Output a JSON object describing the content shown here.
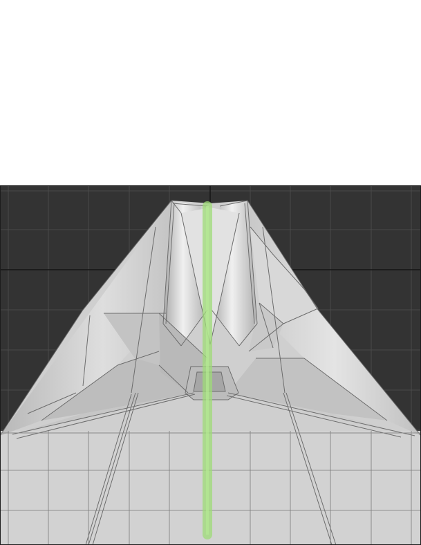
{
  "viewport": {
    "background_color": "#333333",
    "grid_color": "#4a4a4a",
    "axis_color": "#111111",
    "model_fill": "#d0d0d0",
    "model_shade": "#a9a9a9",
    "model_highlight": "#ececec",
    "edge_color": "#6e6e6e",
    "guide_color": "#9fdc78",
    "icons": [
      "folded-model-mesh",
      "vertical-guide-line"
    ]
  }
}
